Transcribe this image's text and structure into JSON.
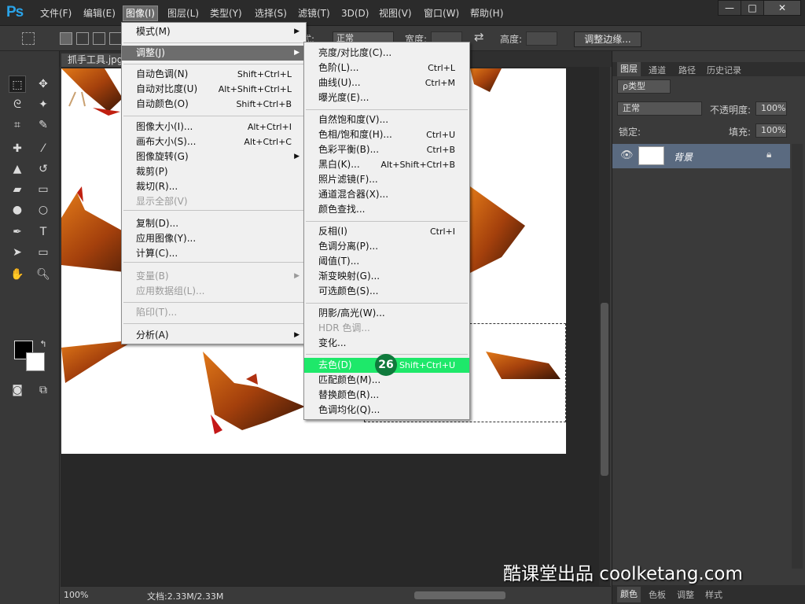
{
  "app": {
    "logo": "Ps"
  },
  "menubar": {
    "items": [
      "文件(F)",
      "编辑(E)",
      "图像(I)",
      "图层(L)",
      "类型(Y)",
      "选择(S)",
      "滤镜(T)",
      "3D(D)",
      "视图(V)",
      "窗口(W)",
      "帮助(H)"
    ],
    "active_index": 2,
    "window_buttons": [
      "—",
      "□",
      "✕"
    ]
  },
  "options": {
    "style_label": "样式:",
    "style_value": "正常",
    "width_label": "宽度:",
    "height_label": "高度:",
    "refine_button": "调整边缘..."
  },
  "document": {
    "tab_title": "抓手工具.jpg"
  },
  "status": {
    "zoom": "100%",
    "docinfo": "文档:2.33M/2.33M"
  },
  "layers_panel": {
    "tabs": [
      "图层",
      "通道",
      "路径",
      "历史记录"
    ],
    "filter_type": "ρ类型",
    "blend_mode": "正常",
    "opacity_label": "不透明度:",
    "opacity_value": "100%",
    "lock_label": "锁定:",
    "fill_label": "填充:",
    "fill_value": "100%",
    "layer_name": "背景",
    "bottom_tabs": [
      "颜色",
      "色板",
      "调整",
      "样式"
    ]
  },
  "image_menu": {
    "items": [
      {
        "label": "模式(M)",
        "submenu": true
      },
      {
        "label": "调整(J)",
        "submenu": true,
        "highlight": true
      },
      {
        "label": "自动色调(N)",
        "shortcut": "Shift+Ctrl+L"
      },
      {
        "label": "自动对比度(U)",
        "shortcut": "Alt+Shift+Ctrl+L"
      },
      {
        "label": "自动颜色(O)",
        "shortcut": "Shift+Ctrl+B"
      },
      {
        "label": "图像大小(I)...",
        "shortcut": "Alt+Ctrl+I"
      },
      {
        "label": "画布大小(S)...",
        "shortcut": "Alt+Ctrl+C"
      },
      {
        "label": "图像旋转(G)",
        "submenu": true
      },
      {
        "label": "裁剪(P)"
      },
      {
        "label": "裁切(R)..."
      },
      {
        "label": "显示全部(V)",
        "disabled": true
      },
      {
        "label": "复制(D)..."
      },
      {
        "label": "应用图像(Y)..."
      },
      {
        "label": "计算(C)..."
      },
      {
        "label": "变量(B)",
        "submenu": true,
        "disabled": true
      },
      {
        "label": "应用数据组(L)...",
        "disabled": true
      },
      {
        "label": "陷印(T)...",
        "disabled": true
      },
      {
        "label": "分析(A)",
        "submenu": true
      }
    ]
  },
  "adjust_menu": {
    "items": [
      {
        "label": "亮度/对比度(C)..."
      },
      {
        "label": "色阶(L)...",
        "shortcut": "Ctrl+L"
      },
      {
        "label": "曲线(U)...",
        "shortcut": "Ctrl+M"
      },
      {
        "label": "曝光度(E)..."
      },
      {
        "label": "自然饱和度(V)..."
      },
      {
        "label": "色相/饱和度(H)...",
        "shortcut": "Ctrl+U"
      },
      {
        "label": "色彩平衡(B)...",
        "shortcut": "Ctrl+B"
      },
      {
        "label": "黑白(K)...",
        "shortcut": "Alt+Shift+Ctrl+B"
      },
      {
        "label": "照片滤镜(F)..."
      },
      {
        "label": "通道混合器(X)..."
      },
      {
        "label": "颜色查找..."
      },
      {
        "label": "反相(I)",
        "shortcut": "Ctrl+I"
      },
      {
        "label": "色调分离(P)..."
      },
      {
        "label": "阈值(T)..."
      },
      {
        "label": "渐变映射(G)..."
      },
      {
        "label": "可选颜色(S)..."
      },
      {
        "label": "阴影/高光(W)..."
      },
      {
        "label": "HDR 色调...",
        "disabled": true
      },
      {
        "label": "变化..."
      },
      {
        "label": "去色(D)",
        "shortcut": "Shift+Ctrl+U",
        "green": true
      },
      {
        "label": "匹配颜色(M)..."
      },
      {
        "label": "替换颜色(R)..."
      },
      {
        "label": "色调均化(Q)..."
      }
    ]
  },
  "step_badge": "26",
  "watermark": "酷课堂出品 coolketang.com",
  "colors": {
    "highlight_green": "#1ee86a",
    "badge_green": "#0f7a3c",
    "menu_bg": "#f0f0f0",
    "ps_blue": "#2aa3e8"
  }
}
